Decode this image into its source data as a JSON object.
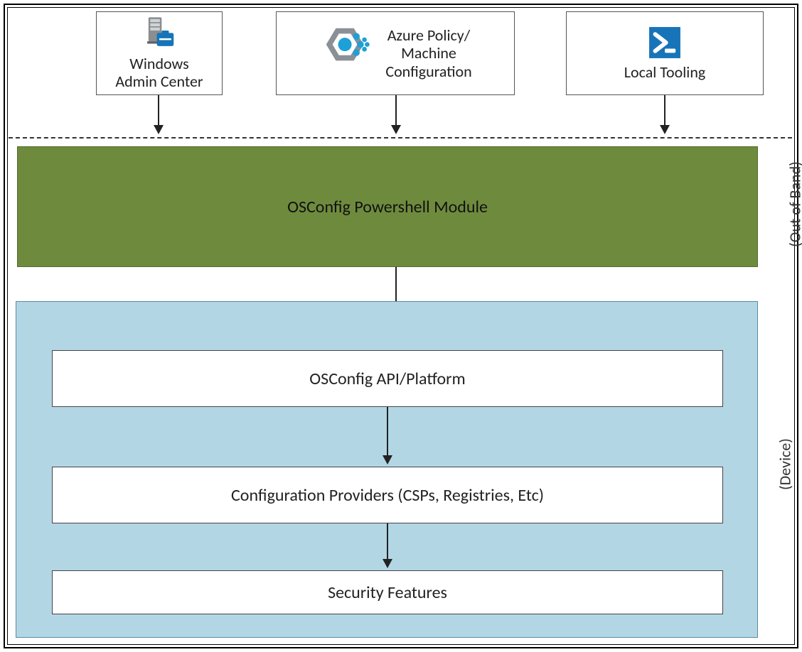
{
  "top_tools": {
    "windows_admin_center": "Windows\nAdmin Center",
    "azure_policy": "Azure Policy/\nMachine\nConfiguration",
    "local_tooling": "Local Tooling"
  },
  "module_label": "OSConfig Powershell Module",
  "device_inner": {
    "api_platform": "OSConfig API/Platform",
    "config_providers": "Configuration Providers (CSPs, Registries, Etc)",
    "security_features": "Security Features"
  },
  "side_labels": {
    "out_of_band": "(Out of Band)",
    "device": "(Device)"
  },
  "icons": {
    "server": "server-briefcase-icon",
    "hex": "hex-dots-icon",
    "powershell": "powershell-icon"
  },
  "colors": {
    "module_bg": "#6e8b3d",
    "device_bg": "#b3d6e5",
    "ps_blue": "#1774b8"
  }
}
